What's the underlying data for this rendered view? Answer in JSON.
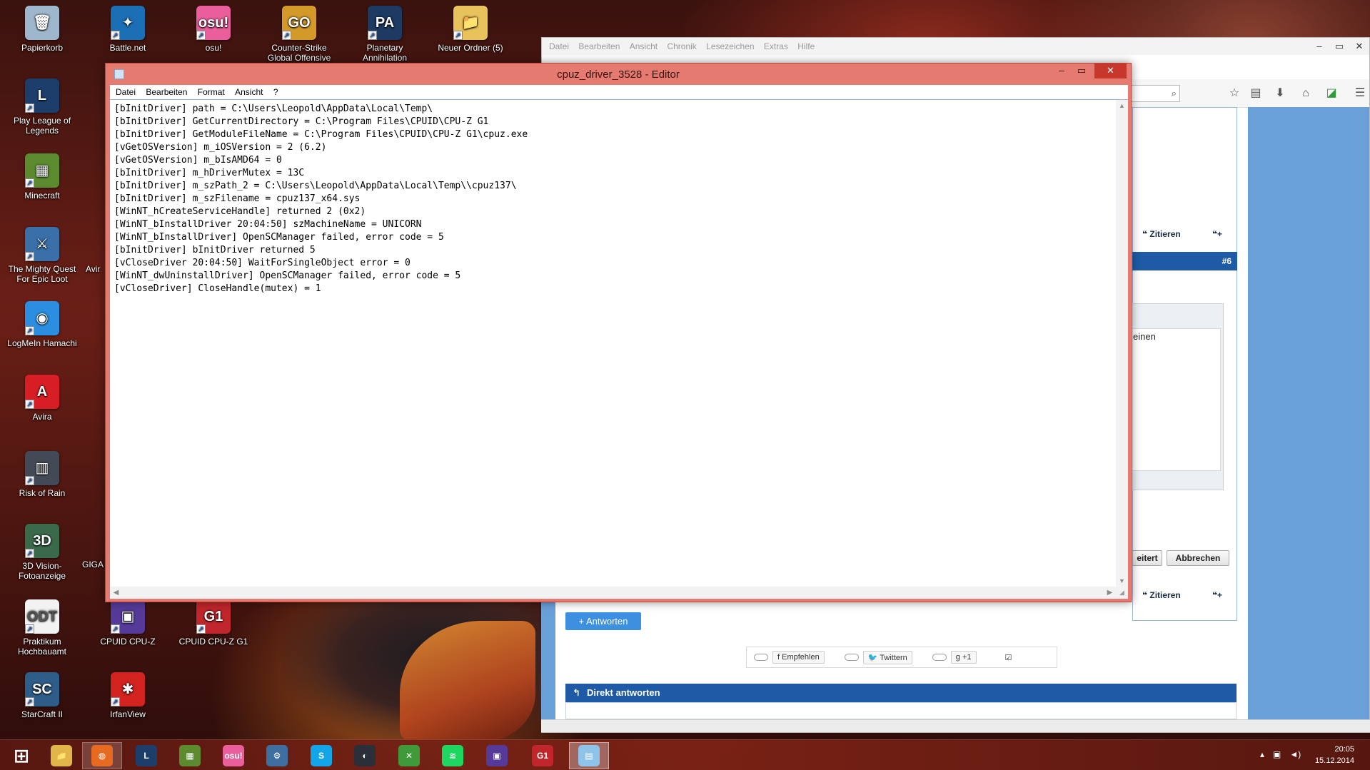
{
  "desktop_icons": [
    {
      "label": "Papierkorb",
      "glyph": "🗑",
      "color": "#9fb7cc"
    },
    {
      "label": "Play League of Legends",
      "glyph": "L",
      "color": "#1d3d6b"
    },
    {
      "label": "Minecraft",
      "glyph": "▦",
      "color": "#5b8a2f"
    },
    {
      "label": "The Mighty Quest For Epic Loot",
      "glyph": "⚔",
      "color": "#3a6fa8"
    },
    {
      "label": "LogMeIn Hamachi",
      "glyph": "◉",
      "color": "#2b8ee0"
    },
    {
      "label": "Avira",
      "glyph": "A",
      "color": "#d81e25"
    },
    {
      "label": "Risk of Rain",
      "glyph": "▥",
      "color": "#444a55"
    },
    {
      "label": "3D Vision-Fotoanzeige",
      "glyph": "3D",
      "color": "#3b6a4a"
    },
    {
      "label": "Praktikum Hochbauamt",
      "glyph": "ODT",
      "color": "#f2f2f2"
    },
    {
      "label": "StarCraft II",
      "glyph": "SC",
      "color": "#2f5d8a"
    },
    {
      "label": "Battle.net",
      "glyph": "✦",
      "color": "#1a6fb5"
    },
    {
      "label": "osu!",
      "glyph": "osu!",
      "color": "#ea5f9b"
    },
    {
      "label": "Counter-Strike Global Offensive",
      "glyph": "GO",
      "color": "#d39a2a"
    },
    {
      "label": "Planetary Annihilation",
      "glyph": "PA",
      "color": "#1d3a63"
    },
    {
      "label": "Neuer Ordner (5)",
      "glyph": "📁",
      "color": "#e8c25a"
    },
    {
      "label": "CPUID CPU-Z",
      "glyph": "▣",
      "color": "#553a99"
    },
    {
      "label": "CPUID CPU-Z G1",
      "glyph": "G1",
      "color": "#c0262b"
    },
    {
      "label": "IrfanView",
      "glyph": "✱",
      "color": "#d2231f"
    },
    {
      "label": "Avir",
      "glyph": "",
      "color": ""
    },
    {
      "label": "GIGA",
      "glyph": "",
      "color": ""
    }
  ],
  "firefox": {
    "menu": [
      "Datei",
      "Bearbeiten",
      "Ansicht",
      "Chronik",
      "Lesezeichen",
      "Extras",
      "Hilfe"
    ],
    "quote_label": "Zitieren",
    "post_number": "#6",
    "edit_text": "einen",
    "btn_weiter": "eitert",
    "btn_abbrechen": "Abbrechen",
    "antworten": "+ Antworten",
    "share": {
      "empfehlen": "Empfehlen",
      "twittern": "Twittern",
      "plus_one": "+1"
    },
    "direkt_antworten": "Direkt antworten"
  },
  "editor": {
    "title": "cpuz_driver_3528 - Editor",
    "menu": [
      "Datei",
      "Bearbeiten",
      "Format",
      "Ansicht",
      "?"
    ],
    "lines": [
      "[bInitDriver] path = C:\\Users\\Leopold\\AppData\\Local\\Temp\\",
      "[bInitDriver] GetCurrentDirectory = C:\\Program Files\\CPUID\\CPU-Z G1",
      "[bInitDriver] GetModuleFileName = C:\\Program Files\\CPUID\\CPU-Z G1\\cpuz.exe",
      "[vGetOSVersion] m_iOSVersion = 2 (6.2)",
      "[vGetOSVersion] m_bIsAMD64 = 0",
      "[bInitDriver] m_hDriverMutex = 13C",
      "[bInitDriver] m_szPath_2 = C:\\Users\\Leopold\\AppData\\Local\\Temp\\\\cpuz137\\",
      "[bInitDriver] m_szFilename = cpuz137_x64.sys",
      "[WinNT_hCreateServiceHandle] returned 2 (0x2)",
      "[WinNT_bInstallDriver 20:04:50] szMachineName = UNICORN",
      "[WinNT_bInstallDriver] OpenSCManager failed, error code = 5",
      "[bInitDriver] bInitDriver returned 5",
      "[vCloseDriver 20:04:50] WaitForSingleObject error = 0",
      "[WinNT_dwUninstallDriver] OpenSCManager failed, error code = 5",
      "[vCloseDriver] CloseHandle(mutex) = 1"
    ]
  },
  "taskbar": {
    "items": [
      {
        "name": "start-button",
        "glyph": "⊞",
        "color": "transparent"
      },
      {
        "name": "explorer",
        "glyph": "📁",
        "color": "#e0b64a"
      },
      {
        "name": "firefox",
        "glyph": "◍",
        "color": "#e66a1f"
      },
      {
        "name": "league-of-legends",
        "glyph": "L",
        "color": "#1d3d6b"
      },
      {
        "name": "minecraft",
        "glyph": "▦",
        "color": "#5b8a2f"
      },
      {
        "name": "osu",
        "glyph": "osu!",
        "color": "#ea5f9b"
      },
      {
        "name": "steam-settings",
        "glyph": "⚙",
        "color": "#3f6fa0"
      },
      {
        "name": "skype",
        "glyph": "S",
        "color": "#12a5e8"
      },
      {
        "name": "steam",
        "glyph": "◐",
        "color": "#2a2f3a"
      },
      {
        "name": "xbox",
        "glyph": "✕",
        "color": "#3f9a3a"
      },
      {
        "name": "spotify",
        "glyph": "≋",
        "color": "#1ed760"
      },
      {
        "name": "cpu-z",
        "glyph": "▣",
        "color": "#553a99"
      },
      {
        "name": "cpu-z-g1",
        "glyph": "G1",
        "color": "#c0262b"
      },
      {
        "name": "notepad",
        "glyph": "▤",
        "color": "#8fc4ea"
      }
    ],
    "time": "20:05",
    "date": "15.12.2014"
  }
}
